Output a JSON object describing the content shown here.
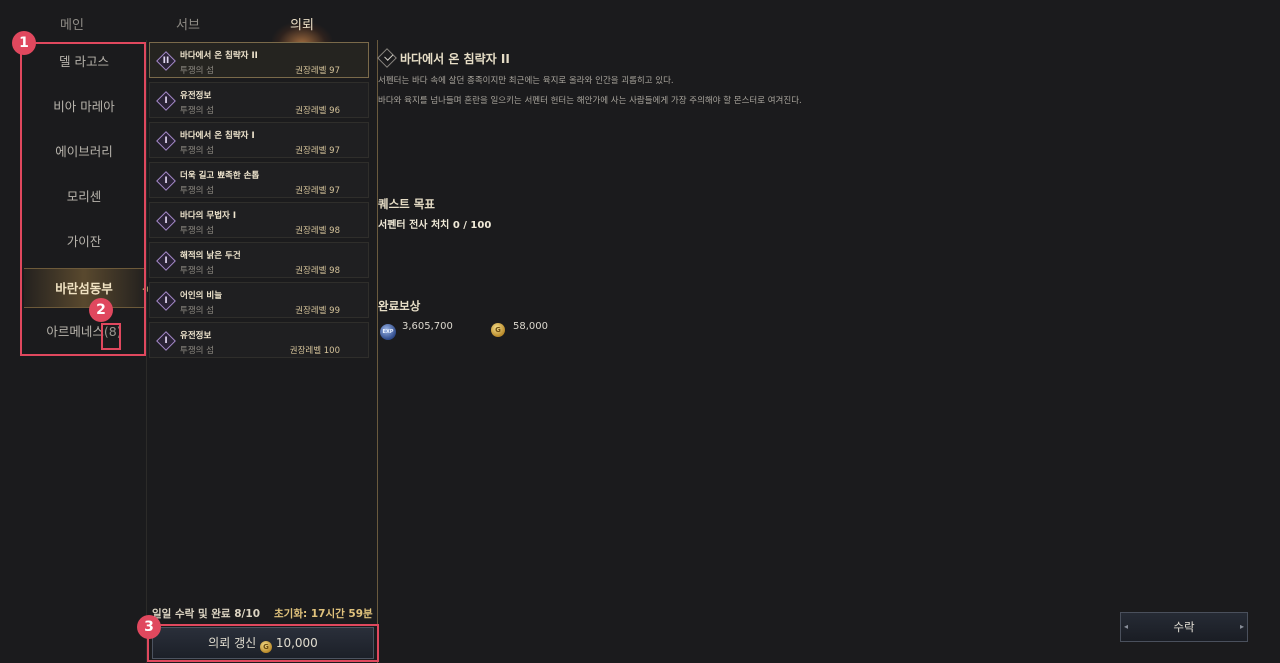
{
  "tabs": [
    "메인",
    "서브",
    "의뢰"
  ],
  "regions": [
    {
      "label": "델 라고스",
      "count": ""
    },
    {
      "label": "비아 마레아",
      "count": ""
    },
    {
      "label": "에이브러리",
      "count": ""
    },
    {
      "label": "모리센",
      "count": ""
    },
    {
      "label": "가이잔",
      "count": ""
    },
    {
      "label": "바란섬동부",
      "count": ""
    },
    {
      "label": "아르메네스",
      "count": "(8)"
    }
  ],
  "quests": [
    {
      "numeral": "II",
      "title": "바다에서 온 침략자 II",
      "zone": "투쟁의 섬",
      "level": "권장레벨 97"
    },
    {
      "numeral": "I",
      "title": "유전정보",
      "zone": "투쟁의 섬",
      "level": "권장레벨 96"
    },
    {
      "numeral": "I",
      "title": "바다에서 온 침략자 I",
      "zone": "투쟁의 섬",
      "level": "권장레벨 97"
    },
    {
      "numeral": "I",
      "title": "더욱 길고 뾰족한 손톱",
      "zone": "투쟁의 섬",
      "level": "권장레벨 97"
    },
    {
      "numeral": "I",
      "title": "바다의 무법자 I",
      "zone": "투쟁의 섬",
      "level": "권장레벨 98"
    },
    {
      "numeral": "I",
      "title": "해적의 낡은 두건",
      "zone": "투쟁의 섬",
      "level": "권장레벨 98"
    },
    {
      "numeral": "I",
      "title": "어인의 비늘",
      "zone": "투쟁의 섬",
      "level": "권장레벨 99"
    },
    {
      "numeral": "I",
      "title": "유전정보",
      "zone": "투쟁의 섬",
      "level": "권장레벨 100"
    }
  ],
  "footer": {
    "daily": "일일 수락 및 완료 8/10",
    "reset": "초기화: 17시간 59분",
    "refresh_label": "의뢰 갱신",
    "refresh_cost": "10,000"
  },
  "detail": {
    "title": "바다에서 온 침략자 II",
    "desc1": "서펜터는 바다 속에 살던 종족이지만 최근에는 육지로 올라와 인간을 괴롭히고 있다.",
    "desc2": "바다와 육지를 넘나들며 혼란을 일으키는 서펜터 헌터는 해안가에 사는 사람들에게 가장 주의해야 할 몬스터로 여겨진다.",
    "objective_header": "퀘스트 목표",
    "objective": "서펜터 전사 처치 0 / 100",
    "reward_header": "완료보상",
    "reward_exp_icon": "EXP",
    "reward_exp": "3,605,700",
    "reward_gold": "58,000"
  },
  "accept_label": "수락",
  "annotations": [
    "1",
    "2",
    "3"
  ],
  "colors": {
    "annotation": "#e0485e",
    "accent_gold": "#e0c27c"
  }
}
